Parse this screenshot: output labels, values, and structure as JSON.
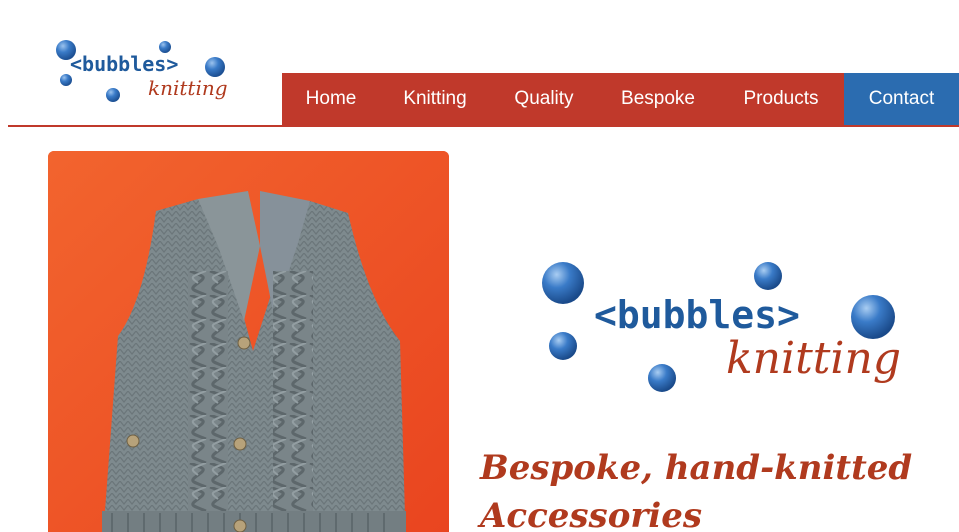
{
  "header": {
    "logo": {
      "brand": "<bubbles>",
      "sub": "knitting"
    },
    "nav": [
      {
        "label": "Home",
        "active": false
      },
      {
        "label": "Knitting",
        "active": false
      },
      {
        "label": "Quality",
        "active": false
      },
      {
        "label": "Bespoke",
        "active": false
      },
      {
        "label": "Products",
        "active": false
      },
      {
        "label": "Contact",
        "active": true
      }
    ]
  },
  "main": {
    "photo": {
      "subject": "grey hand-knitted waistcoat on orange background"
    },
    "logo": {
      "brand": "<bubbles>",
      "sub": "knitting"
    },
    "title": "Bespoke, hand-knitted Accessories"
  },
  "colors": {
    "nav_bg": "#c0392b",
    "nav_active": "#2b6cb0",
    "brand_blue": "#1f5a9c",
    "script_red": "#b03a1e",
    "bubble": "#2f6db5"
  }
}
